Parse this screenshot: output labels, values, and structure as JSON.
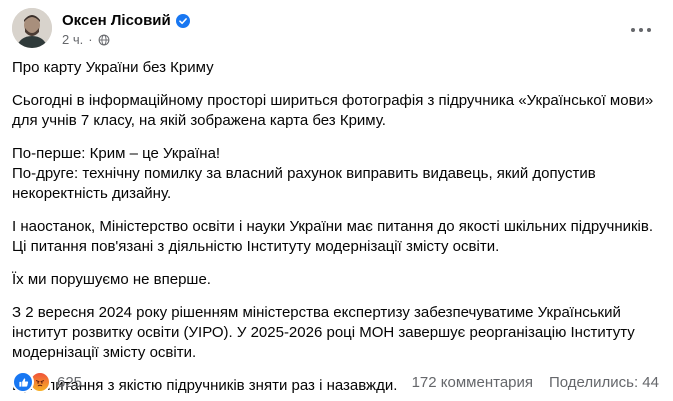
{
  "post": {
    "author": "Оксен Лісовий",
    "time": "2 ч.",
    "paragraphs": [
      "Про карту України без Криму",
      "Сьогодні в інформаційному просторі шириться фотографія з підручника «Української мови»\nдля учнів 7 класу, на якій зображена карта без Криму.",
      "По-перше: Крим – це Україна!\nПо-друге: технічну помилку за власний рахунок виправить видавець, який допустив\nнекоректність дизайну.",
      "І наостанок, Міністерство освіти і науки України має питання до якості шкільних підручників.\nЦі питання пов'язані з діяльністю Інституту модернізації змісту освіти.",
      "Їх ми порушуємо не вперше.",
      "З 2 вересня 2024 року рішенням міністерства експертизу забезпечуватиме Український\nінститут розвитку освіти (УІРО). У 2025-2026 році МОН завершує реорганізацію Інституту\nмодернізації змісту освіти.",
      "Щоб питання з якістю підручників зняти раз і назавжди."
    ]
  },
  "footer": {
    "reactions_count": "625",
    "comments": "172 комментария",
    "shares": "Поделились: 44"
  },
  "colors": {
    "like": "#1877f2",
    "verified": "#1877f2",
    "secondary_text": "#65676b"
  }
}
